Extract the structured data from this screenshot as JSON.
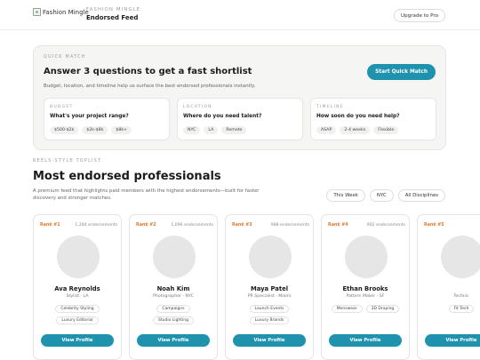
{
  "header": {
    "logo_alt": "Fashion Mingle",
    "eyebrow": "FASHION MINGLE",
    "title": "Endorsed Feed",
    "upgrade_label": "Upgrade to Pro"
  },
  "quick_match": {
    "eyebrow": "QUICK MATCH",
    "title": "Answer 3 questions to get a fast shortlist",
    "subtitle": "Budget, location, and timeline help us surface the best endorsed professionals instantly.",
    "cta_label": "Start Quick Match",
    "questions": [
      {
        "eyebrow": "BUDGET",
        "label": "What's your project range?",
        "options": [
          "$500-$2k",
          "$2k-$8k",
          "$8k+"
        ]
      },
      {
        "eyebrow": "LOCATION",
        "label": "Where do you need talent?",
        "options": [
          "NYC",
          "LA",
          "Remote"
        ]
      },
      {
        "eyebrow": "TIMELINE",
        "label": "How soon do you need help?",
        "options": [
          "ASAP",
          "2-4 weeks",
          "Flexible"
        ]
      }
    ]
  },
  "toplist": {
    "eyebrow": "REELS-STYLE TOPLIST",
    "title": "Most endorsed professionals",
    "description": "A premium feed that highlights paid members with the highest endorsements—built for faster discovery and stronger matches.",
    "filters": [
      "This Week",
      "NYC",
      "All Disciplines"
    ],
    "cards": [
      {
        "rank": "Rank #1",
        "endorsements": "1,284 endorsements",
        "name": "Ava Reynolds",
        "role": "Stylist · LA",
        "tags": [
          "Celebrity Styling",
          "Luxury Editorial"
        ],
        "cta": "View Profile"
      },
      {
        "rank": "Rank #2",
        "endorsements": "1,096 endorsements",
        "name": "Noah Kim",
        "role": "Photographer · NYC",
        "tags": [
          "Campaigns",
          "Studio Lighting"
        ],
        "cta": "View Profile"
      },
      {
        "rank": "Rank #3",
        "endorsements": "988 endorsements",
        "name": "Maya Patel",
        "role": "PR Specialist · Miami",
        "tags": [
          "Launch Events",
          "Luxury Brands"
        ],
        "cta": "View Profile"
      },
      {
        "rank": "Rank #4",
        "endorsements": "902 endorsements",
        "name": "Ethan Brooks",
        "role": "Pattern Maker · SF",
        "tags": [
          "Menswear",
          "3D Draping"
        ],
        "cta": "View Profile"
      },
      {
        "rank": "Rank #5",
        "endorsements": "",
        "name": "",
        "role": "Technic",
        "tags": [
          "Fit Tech"
        ],
        "cta": "View Profile"
      }
    ]
  },
  "colors": {
    "accent": "#1f93ad",
    "rank": "#e07a2c"
  }
}
